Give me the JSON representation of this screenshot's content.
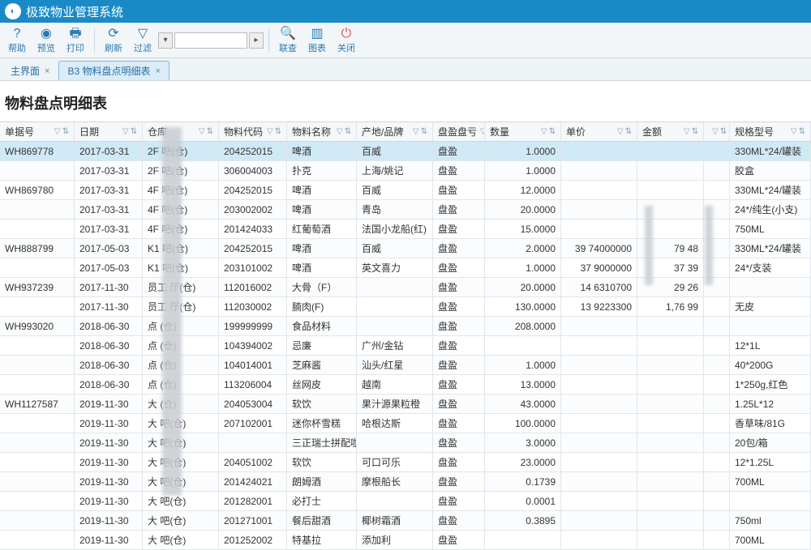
{
  "app": {
    "title": "极致物业管理系统"
  },
  "toolbar": {
    "help": "帮助",
    "preview": "预览",
    "print": "打印",
    "refresh": "刷新",
    "filter": "过滤",
    "search_placeholder": "",
    "union": "联查",
    "chart": "图表",
    "close": "关闭"
  },
  "tabs": {
    "main": "主界面",
    "active": "B3 物料盘点明细表"
  },
  "report": {
    "title": "物料盘点明细表"
  },
  "columns": [
    "单据号",
    "日期",
    "仓库",
    "物料代码",
    "物料名称",
    "产地/品牌",
    "盘盈盘亏",
    "数量",
    "单价",
    "金额",
    "",
    "规格型号"
  ],
  "rows": [
    {
      "no": "WH869778",
      "date": "2017-03-31",
      "wh": "2F     吧(仓)",
      "code": "204252015",
      "name": "啤酒",
      "brand": "百威",
      "type": "盘盈",
      "qty": "1.0000",
      "price": "",
      "amt": "",
      "ext": "",
      "spec": "330ML*24/罐装"
    },
    {
      "no": "",
      "date": "2017-03-31",
      "wh": "2F     吧(仓)",
      "code": "306004003",
      "name": "扑克",
      "brand": "上海/姚记",
      "type": "盘盈",
      "qty": "1.0000",
      "price": "",
      "amt": "",
      "ext": "",
      "spec": "胶盒"
    },
    {
      "no": "WH869780",
      "date": "2017-03-31",
      "wh": "4F     吧(仓)",
      "code": "204252015",
      "name": "啤酒",
      "brand": "百威",
      "type": "盘盈",
      "qty": "12.0000",
      "price": "",
      "amt": "",
      "ext": "",
      "spec": "330ML*24/罐装"
    },
    {
      "no": "",
      "date": "2017-03-31",
      "wh": "4F     吧(仓)",
      "code": "203002002",
      "name": "啤酒",
      "brand": "青岛",
      "type": "盘盈",
      "qty": "20.0000",
      "price": "",
      "amt": "",
      "ext": "",
      "spec": "24*/纯生(小支)"
    },
    {
      "no": "",
      "date": "2017-03-31",
      "wh": "4F     吧(仓)",
      "code": "201424033",
      "name": "红葡萄酒",
      "brand": "法国小龙船(红)",
      "type": "盘盈",
      "qty": "15.0000",
      "price": "",
      "amt": "",
      "ext": "",
      "spec": "750ML"
    },
    {
      "no": "WH888799",
      "date": "2017-05-03",
      "wh": "K1   吧(仓)",
      "code": "204252015",
      "name": "啤酒",
      "brand": "百威",
      "type": "盘盈",
      "qty": "2.0000",
      "price": "39  74000000",
      "amt": "79  48",
      "ext": "",
      "spec": "330ML*24/罐装"
    },
    {
      "no": "",
      "date": "2017-05-03",
      "wh": "K1   吧(仓)",
      "code": "203101002",
      "name": "啤酒",
      "brand": "英文喜力",
      "type": "盘盈",
      "qty": "1.0000",
      "price": "37   9000000",
      "amt": "37 39",
      "ext": "",
      "spec": "24*/支装"
    },
    {
      "no": "WH937239",
      "date": "2017-11-30",
      "wh": "员工  厅(仓)",
      "code": "112016002",
      "name": "大骨（F）",
      "brand": "",
      "type": "盘盈",
      "qty": "20.0000",
      "price": "14   6310700",
      "amt": "29  26",
      "ext": "",
      "spec": ""
    },
    {
      "no": "",
      "date": "2017-11-30",
      "wh": "员工  厅(仓)",
      "code": "112030002",
      "name": "腩肉(F)",
      "brand": "",
      "type": "盘盈",
      "qty": "130.0000",
      "price": "13   9223300",
      "amt": "1,76  99",
      "ext": "",
      "spec": "无皮"
    },
    {
      "no": "WH993020",
      "date": "2018-06-30",
      "wh": "点    (仓)",
      "code": "199999999",
      "name": "食品材料",
      "brand": "",
      "type": "盘盈",
      "qty": "208.0000",
      "price": "",
      "amt": "",
      "ext": "",
      "spec": ""
    },
    {
      "no": "",
      "date": "2018-06-30",
      "wh": "点    (仓)",
      "code": "104394002",
      "name": "忌廉",
      "brand": "广州/金钻",
      "type": "盘盈",
      "qty": "",
      "price": "",
      "amt": "",
      "ext": "",
      "spec": "12*1L"
    },
    {
      "no": "",
      "date": "2018-06-30",
      "wh": "点    (仓)",
      "code": "104014001",
      "name": "芝麻酱",
      "brand": "汕头/红星",
      "type": "盘盈",
      "qty": "1.0000",
      "price": "",
      "amt": "",
      "ext": "",
      "spec": "40*200G"
    },
    {
      "no": "",
      "date": "2018-06-30",
      "wh": "点    (仓)",
      "code": "113206004",
      "name": "丝网皮",
      "brand": "越南",
      "type": "盘盈",
      "qty": "13.0000",
      "price": "",
      "amt": "",
      "ext": "",
      "spec": "1*250g,红色"
    },
    {
      "no": "WH1127587",
      "date": "2019-11-30",
      "wh": "大    (仓)",
      "code": "204053004",
      "name": "软饮",
      "brand": "果汁源果粒橙",
      "type": "盘盈",
      "qty": "43.0000",
      "price": "",
      "amt": "",
      "ext": "",
      "spec": "1.25L*12"
    },
    {
      "no": "",
      "date": "2019-11-30",
      "wh": "大   吧(仓)",
      "code": "207102001",
      "name": "迷你杯雪糕",
      "brand": "哈根达斯",
      "type": "盘盈",
      "qty": "100.0000",
      "price": "",
      "amt": "",
      "ext": "",
      "spec": "香草味/81G"
    },
    {
      "no": "",
      "date": "2019-11-30",
      "wh": "大   吧(仓)",
      "code": "",
      "name": "三正瑞士拼配咖",
      "brand": "",
      "type": "盘盈",
      "qty": "3.0000",
      "price": "",
      "amt": "",
      "ext": "",
      "spec": "20包/箱"
    },
    {
      "no": "",
      "date": "2019-11-30",
      "wh": "大   吧(仓)",
      "code": "204051002",
      "name": "软饮",
      "brand": "可口可乐",
      "type": "盘盈",
      "qty": "23.0000",
      "price": "",
      "amt": "",
      "ext": "",
      "spec": "12*1.25L"
    },
    {
      "no": "",
      "date": "2019-11-30",
      "wh": "大   吧(仓)",
      "code": "201424021",
      "name": "朗姆酒",
      "brand": "摩根船长",
      "type": "盘盈",
      "qty": "0.1739",
      "price": "",
      "amt": "",
      "ext": "",
      "spec": "700ML"
    },
    {
      "no": "",
      "date": "2019-11-30",
      "wh": "大   吧(仓)",
      "code": "201282001",
      "name": "必打士",
      "brand": "",
      "type": "盘盈",
      "qty": "0.0001",
      "price": "",
      "amt": "",
      "ext": "",
      "spec": ""
    },
    {
      "no": "",
      "date": "2019-11-30",
      "wh": "大   吧(仓)",
      "code": "201271001",
      "name": "餐后甜酒",
      "brand": "椰树霜酒",
      "type": "盘盈",
      "qty": "0.3895",
      "price": "",
      "amt": "",
      "ext": "",
      "spec": "750ml"
    },
    {
      "no": "",
      "date": "2019-11-30",
      "wh": "大   吧(仓)",
      "code": "201252002",
      "name": "特基拉",
      "brand": "添加利",
      "type": "盘盈",
      "qty": "",
      "price": "",
      "amt": "",
      "ext": "",
      "spec": "700ML"
    }
  ]
}
